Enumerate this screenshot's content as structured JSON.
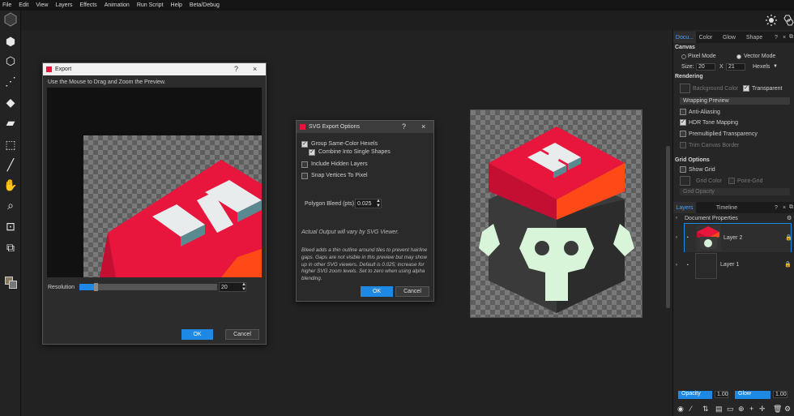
{
  "menu": [
    "File",
    "Edit",
    "View",
    "Layers",
    "Effects",
    "Animation",
    "Run Script",
    "Help",
    "Beta/Debug"
  ],
  "colors": {
    "accent": "#1e88e5",
    "cube_red": "#e8153d",
    "cube_orange": "#ff4a17",
    "skull": "#d9f5d9"
  },
  "toolbar": {
    "icons": [
      "hexagon-fill-icon",
      "hexagon-outline-icon",
      "line-icon",
      "bucket-icon",
      "eraser-icon",
      "select-icon",
      "picker-icon",
      "hand-icon",
      "zoom-icon",
      "crop-icon",
      "transform-icon",
      "color-swatch-icon"
    ]
  },
  "export_dialog": {
    "title": "Export",
    "help": "?",
    "close": "×",
    "instruction": "Use the Mouse to Drag and Zoom the Preview.",
    "resolution_label": "Resolution",
    "resolution_value": "20",
    "resolution_fraction": 0.12,
    "ok": "OK",
    "cancel": "Cancel"
  },
  "svg_dialog": {
    "title": "SVG Export Options",
    "help": "?",
    "close": "×",
    "group_same_color": "Group Same-Color Hexels",
    "combine_shapes": "Combine Into Single Shapes",
    "include_hidden": "Include Hidden Layers",
    "snap_vertices": "Snap Vertices To Pixel",
    "polygon_bleed_label": "Polygon Bleed (pts)",
    "polygon_bleed_value": "0.025",
    "note1": "Actual Output will vary by SVG Viewer.",
    "note2": "Bleed adds a thin outline around tiles to prevent hairline gaps. Gaps are not visible in this preview but may show up in other SVG viewers. Default is 0.025; increase for higher SVG zoom levels. Set to zero when using alpha blending.",
    "ok": "OK",
    "cancel": "Cancel"
  },
  "right_panel": {
    "tabs": [
      "Docu...",
      "Color",
      "Glow",
      "Shape"
    ],
    "help": "?",
    "close": "×",
    "canvas": {
      "heading": "Canvas",
      "pixel_mode": "Pixel Mode",
      "vector_mode": "Vector Mode",
      "size_label": "Size:",
      "width": "20",
      "x": "X",
      "height": "21",
      "unit": "Hexels"
    },
    "rendering": {
      "heading": "Rendering",
      "background_color": "Background Color",
      "transparent": "Transparent",
      "wrapping_preview": "Wrapping Preview",
      "anti_aliasing": "Anti-Aliasing",
      "hdr": "HDR Tone Mapping",
      "premultiplied": "Premultiplied Transparency",
      "trim_border": "Trim Canvas Border"
    },
    "grid": {
      "heading": "Grid Options",
      "show_grid": "Show Grid",
      "grid_color": "Grid Color",
      "point_grid": "Point-Grid",
      "grid_opacity": "Grid Opacity"
    },
    "layers_tabs": [
      "Layers",
      "Timeline"
    ],
    "document_properties": "Document Properties",
    "layers": [
      {
        "name": "Layer 2"
      },
      {
        "name": "Layer 1"
      }
    ],
    "opacity_label": "Opacity",
    "opacity_value": "1.00",
    "glow_label": "Glow",
    "glow_value": "1.00"
  }
}
